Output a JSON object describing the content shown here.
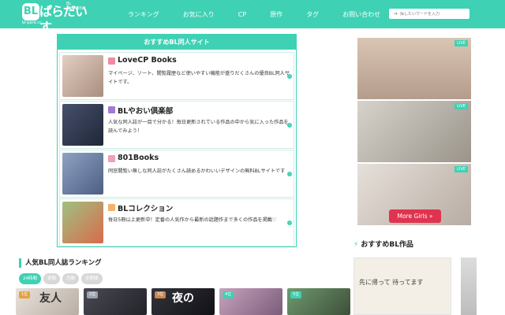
{
  "header": {
    "logo_bl": "BL",
    "logo_jp": "ぱらだいす",
    "logo_sub1": "BL PARADISE",
    "logo_sub2": "bl-para.cc",
    "nav": [
      "ランキング",
      "お気に入り",
      "CP",
      "原作",
      "タグ",
      "お問い合わせ"
    ],
    "search_placeholder": "探したいワードを入力"
  },
  "recommended_sites": {
    "heading": "おすすめBL同人サイト",
    "items": [
      {
        "title": "LoveCP Books",
        "icon_color": "#f08aa3",
        "thumb_color": "#c6a899",
        "desc": "マイページ、ソート、閲覧履歴など使いやすい機能が盛りだくさんの優良BL同人サイトです。"
      },
      {
        "title": "BLやおい倶楽部",
        "icon_color": "#a07ad6",
        "thumb_color": "#2f3c55",
        "desc": "人気な同人誌が一目で分かる！毎日更新されている作品の中から気に入った作品を読んでみよう！"
      },
      {
        "title": "801Books",
        "icon_color": "#f0a0b8",
        "thumb_color": "#6a7fa3",
        "desc": "同窓閲覧い無しな同人誌がたくさん読めるかわいいデザインの無料BLサイトです"
      },
      {
        "title": "BLコレクション",
        "icon_color": "#f3b36a",
        "thumb_color": "#7fa86a",
        "desc": "毎日5冊以上更新中！定番の人気作から最新の話題作まで多くの作品を掲載♡"
      }
    ]
  },
  "ranking": {
    "title": "人気BL同人誌ランキング",
    "tabs": [
      "24時間",
      "週間",
      "月間",
      "全期間"
    ],
    "active_tab": "24時間",
    "items": [
      {
        "rank": "1位",
        "badge_color": "#e6a23c",
        "bg": "#d8d2cb",
        "text": "友人"
      },
      {
        "rank": "2位",
        "badge_color": "#9aa3ad",
        "bg": "#3a3a44",
        "text": ""
      },
      {
        "rank": "3位",
        "badge_color": "#c78850",
        "bg": "#2b2b33",
        "text": "夜の"
      },
      {
        "rank": "4位",
        "badge_color": "#3fd1b4",
        "bg": "#b08aa5",
        "text": ""
      },
      {
        "rank": "5位",
        "badge_color": "#3fd1b4",
        "bg": "#557a5a",
        "text": ""
      }
    ]
  },
  "sidebar": {
    "ads": [
      {
        "live": "LIVE",
        "bg": "#cdb7a6"
      },
      {
        "live": "LIVE",
        "bg": "#b9b4a8"
      },
      {
        "live": "LIVE",
        "bg": "#d6cfc8"
      }
    ],
    "more_girls": "More Girls »",
    "recommended_title": "おすすめBL作品",
    "rec_jp": "先に帰って\n待ってます"
  }
}
